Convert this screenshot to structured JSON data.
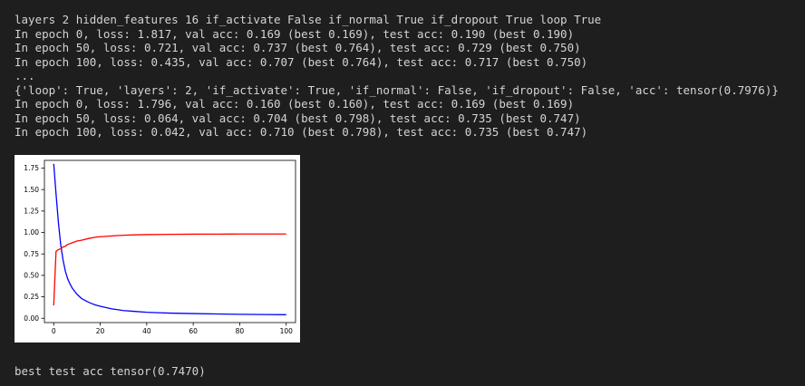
{
  "output": {
    "lines": [
      "layers 2 hidden_features 16 if_activate False if_normal True if_dropout True loop True",
      "In epoch 0, loss: 1.817, val acc: 0.169 (best 0.169), test acc: 0.190 (best 0.190)",
      "In epoch 50, loss: 0.721, val acc: 0.737 (best 0.764), test acc: 0.729 (best 0.750)",
      "In epoch 100, loss: 0.435, val acc: 0.707 (best 0.764), test acc: 0.717 (best 0.750)",
      "...",
      "{'loop': True, 'layers': 2, 'if_activate': True, 'if_normal': False, 'if_dropout': False, 'acc': tensor(0.7976)}",
      "In epoch 0, loss: 1.796, val acc: 0.160 (best 0.160), test acc: 0.169 (best 0.169)",
      "In epoch 50, loss: 0.064, val acc: 0.704 (best 0.798), test acc: 0.735 (best 0.747)",
      "In epoch 100, loss: 0.042, val acc: 0.710 (best 0.798), test acc: 0.735 (best 0.747)"
    ],
    "final_line": "best test acc tensor(0.7470)"
  },
  "chart_data": {
    "type": "line",
    "title": "",
    "xlabel": "",
    "ylabel": "",
    "xlim": [
      -4,
      104
    ],
    "ylim": [
      -0.05,
      1.84
    ],
    "xticks": [
      0,
      20,
      40,
      60,
      80,
      100
    ],
    "yticks": [
      0.0,
      0.25,
      0.5,
      0.75,
      1.0,
      1.25,
      1.5,
      1.75
    ],
    "ytick_labels": [
      "0.00",
      "0.25",
      "0.50",
      "0.75",
      "1.00",
      "1.25",
      "1.50",
      "1.75"
    ],
    "grid": false,
    "legend": "none",
    "series": [
      {
        "color": "#0000ff",
        "x": [
          0,
          1,
          2,
          3,
          4,
          5,
          6,
          7,
          8,
          10,
          12,
          14,
          16,
          18,
          20,
          25,
          30,
          35,
          40,
          45,
          50,
          60,
          70,
          80,
          90,
          100
        ],
        "y": [
          1.8,
          1.45,
          1.12,
          0.86,
          0.68,
          0.55,
          0.46,
          0.4,
          0.35,
          0.28,
          0.23,
          0.2,
          0.175,
          0.155,
          0.14,
          0.11,
          0.09,
          0.08,
          0.07,
          0.065,
          0.06,
          0.055,
          0.05,
          0.046,
          0.044,
          0.042
        ]
      },
      {
        "color": "#ff0000",
        "x": [
          0,
          1,
          2,
          3,
          4,
          5,
          6,
          8,
          10,
          12,
          15,
          18,
          20,
          25,
          30,
          35,
          40,
          50,
          60,
          70,
          80,
          90,
          100
        ],
        "y": [
          0.15,
          0.78,
          0.8,
          0.81,
          0.83,
          0.84,
          0.86,
          0.88,
          0.9,
          0.91,
          0.93,
          0.945,
          0.95,
          0.96,
          0.968,
          0.972,
          0.975,
          0.978,
          0.98,
          0.981,
          0.982,
          0.982,
          0.982
        ]
      }
    ]
  }
}
